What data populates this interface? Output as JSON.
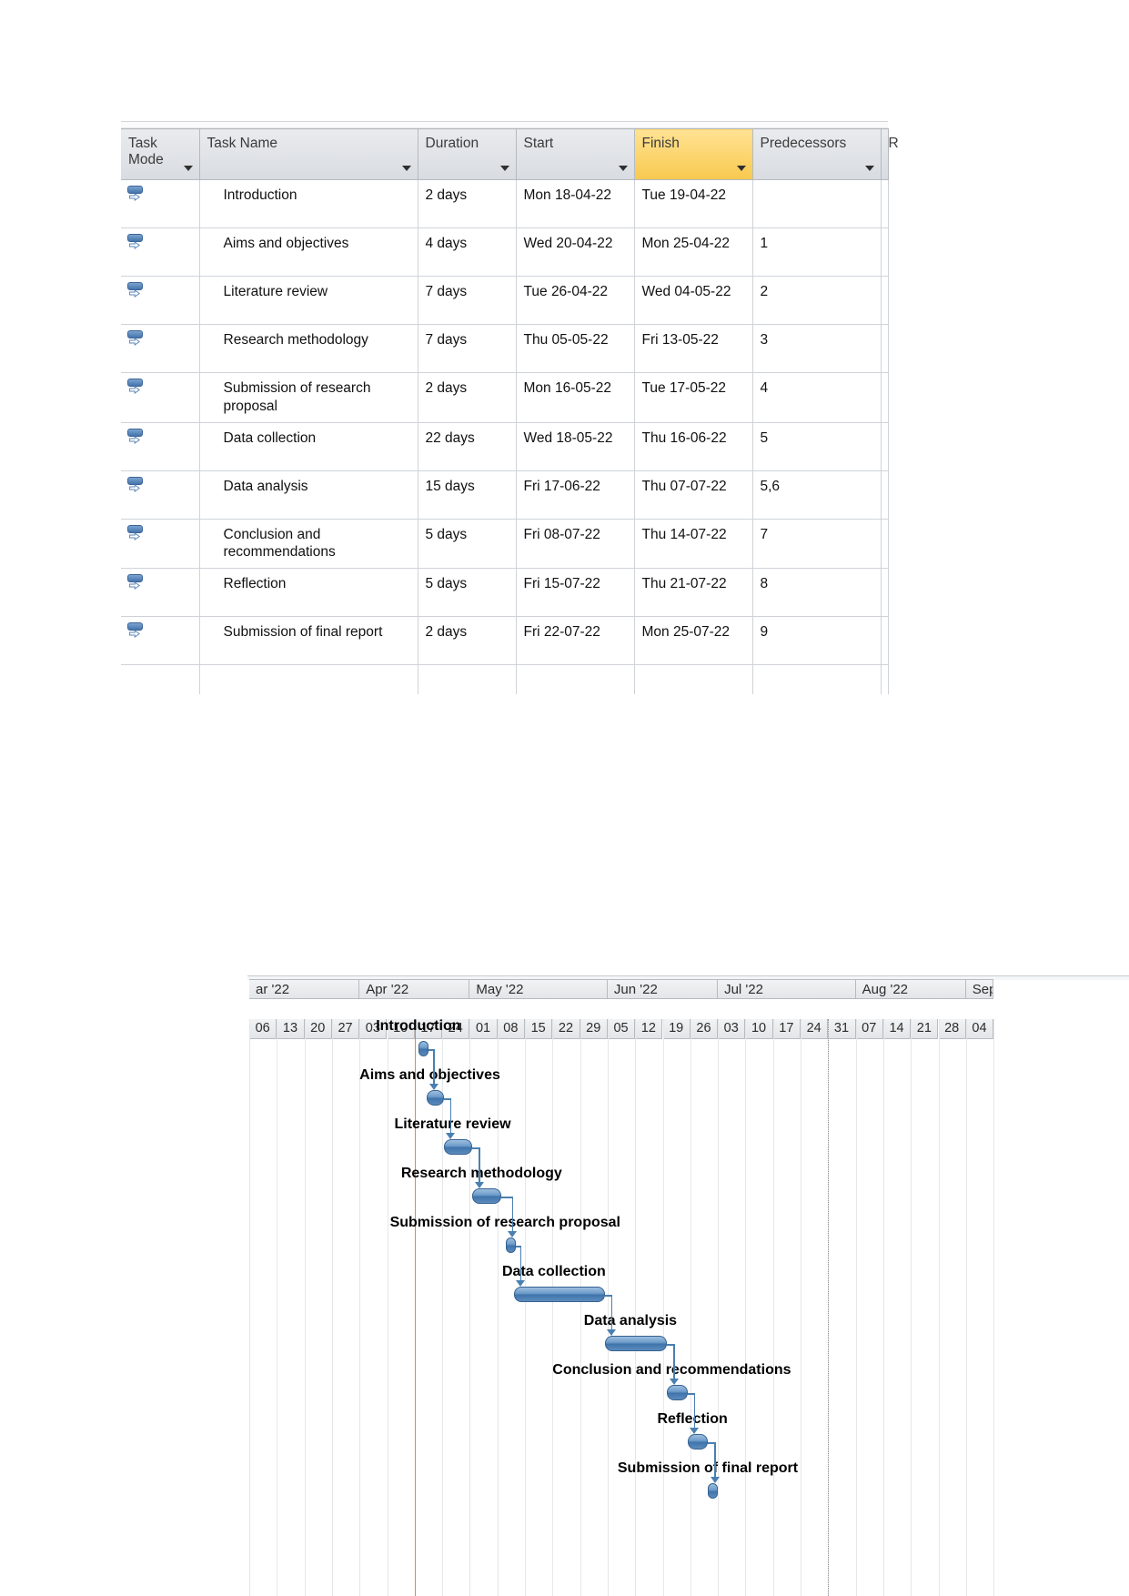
{
  "table": {
    "columns": [
      {
        "key": "mode",
        "label": "Task Mode",
        "highlight": false,
        "filter": true
      },
      {
        "key": "name",
        "label": "Task Name",
        "highlight": false,
        "filter": true
      },
      {
        "key": "dur",
        "label": "Duration",
        "highlight": false,
        "filter": true
      },
      {
        "key": "start",
        "label": "Start",
        "highlight": false,
        "filter": true
      },
      {
        "key": "finish",
        "label": "Finish",
        "highlight": true,
        "filter": true
      },
      {
        "key": "pred",
        "label": "Predecessors",
        "highlight": false,
        "filter": true
      },
      {
        "key": "more",
        "label": "R",
        "highlight": false,
        "filter": false
      }
    ],
    "mode_icon": "manually-scheduled-icon",
    "rows": [
      {
        "mode": "",
        "name": "Introduction",
        "dur": "2 days",
        "start": "Mon 18-04-22",
        "finish": "Tue 19-04-22",
        "pred": ""
      },
      {
        "mode": "",
        "name": "Aims and objectives",
        "dur": "4 days",
        "start": "Wed 20-04-22",
        "finish": "Mon 25-04-22",
        "pred": "1"
      },
      {
        "mode": "",
        "name": "Literature review",
        "dur": "7 days",
        "start": "Tue 26-04-22",
        "finish": "Wed 04-05-22",
        "pred": "2"
      },
      {
        "mode": "",
        "name": "Research methodology",
        "dur": "7 days",
        "start": "Thu 05-05-22",
        "finish": "Fri 13-05-22",
        "pred": "3"
      },
      {
        "mode": "",
        "name": "Submission of research proposal",
        "dur": "2 days",
        "start": "Mon 16-05-22",
        "finish": "Tue 17-05-22",
        "pred": "4"
      },
      {
        "mode": "",
        "name": "Data collection",
        "dur": "22 days",
        "start": "Wed 18-05-22",
        "finish": "Thu 16-06-22",
        "pred": "5"
      },
      {
        "mode": "",
        "name": "Data analysis",
        "dur": "15 days",
        "start": "Fri 17-06-22",
        "finish": "Thu 07-07-22",
        "pred": "5,6"
      },
      {
        "mode": "",
        "name": "Conclusion and recommendations",
        "dur": "5 days",
        "start": "Fri 08-07-22",
        "finish": "Thu 14-07-22",
        "pred": "7"
      },
      {
        "mode": "",
        "name": "Reflection",
        "dur": "5 days",
        "start": "Fri 15-07-22",
        "finish": "Thu 21-07-22",
        "pred": "8"
      },
      {
        "mode": "",
        "name": "Submission of final report",
        "dur": "2 days",
        "start": "Fri 22-07-22",
        "finish": "Mon 25-07-22",
        "pred": "9"
      }
    ]
  },
  "chart_data": {
    "type": "gantt",
    "title": "",
    "timescale": {
      "months": [
        {
          "label": "ar '22",
          "weeks": [
            "06",
            "13",
            "20",
            "27"
          ]
        },
        {
          "label": "Apr '22",
          "weeks": [
            "03",
            "10",
            "17",
            "24"
          ]
        },
        {
          "label": "May '22",
          "weeks": [
            "01",
            "08",
            "15",
            "22",
            "29"
          ]
        },
        {
          "label": "Jun '22",
          "weeks": [
            "05",
            "12",
            "19",
            "26"
          ]
        },
        {
          "label": "Jul '22",
          "weeks": [
            "03",
            "10",
            "17",
            "24",
            "31"
          ]
        },
        {
          "label": "Aug '22",
          "weeks": [
            "07",
            "14",
            "21",
            "28"
          ]
        },
        {
          "label": "Sep",
          "weeks": [
            "04"
          ]
        }
      ]
    },
    "markers": {
      "today_line_color": "#e98a2b",
      "today_line_week_index": 6,
      "dotted_line_color": "#8d9196",
      "dotted_line_week_index": 21
    },
    "bar_color": "#4474ac",
    "tasks": [
      {
        "name": "Introduction",
        "start": "Mon 18-04-22",
        "finish": "Tue 19-04-22",
        "duration_days": 2,
        "start_week": 6.15,
        "span_weeks": 0.3,
        "pred": ""
      },
      {
        "name": "Aims and objectives",
        "start": "Wed 20-04-22",
        "finish": "Mon 25-04-22",
        "duration_days": 4,
        "start_week": 6.45,
        "span_weeks": 0.6,
        "pred": "1"
      },
      {
        "name": "Literature review",
        "start": "Tue 26-04-22",
        "finish": "Wed 04-05-22",
        "duration_days": 7,
        "start_week": 7.05,
        "span_weeks": 1.05,
        "pred": "2"
      },
      {
        "name": "Research methodology",
        "start": "Thu 05-05-22",
        "finish": "Fri 13-05-22",
        "duration_days": 7,
        "start_week": 8.1,
        "span_weeks": 1.05,
        "pred": "3"
      },
      {
        "name": "Submission of research proposal",
        "start": "Mon 16-05-22",
        "finish": "Tue 17-05-22",
        "duration_days": 2,
        "start_week": 9.3,
        "span_weeks": 0.3,
        "pred": "4"
      },
      {
        "name": "Data collection",
        "start": "Wed 18-05-22",
        "finish": "Thu 16-06-22",
        "duration_days": 22,
        "start_week": 9.6,
        "span_weeks": 3.3,
        "pred": "5"
      },
      {
        "name": "Data analysis",
        "start": "Fri 17-06-22",
        "finish": "Thu 07-07-22",
        "duration_days": 15,
        "start_week": 12.9,
        "span_weeks": 2.25,
        "pred": "5,6"
      },
      {
        "name": "Conclusion and recommendations",
        "start": "Fri 08-07-22",
        "finish": "Thu 14-07-22",
        "duration_days": 5,
        "start_week": 15.15,
        "span_weeks": 0.75,
        "pred": "7"
      },
      {
        "name": "Reflection",
        "start": "Fri 15-07-22",
        "finish": "Thu 21-07-22",
        "duration_days": 5,
        "start_week": 15.9,
        "span_weeks": 0.75,
        "pred": "8"
      },
      {
        "name": "Submission of final report",
        "start": "Fri 22-07-22",
        "finish": "Mon 25-07-22",
        "duration_days": 2,
        "start_week": 16.65,
        "span_weeks": 0.3,
        "pred": "9"
      }
    ]
  }
}
